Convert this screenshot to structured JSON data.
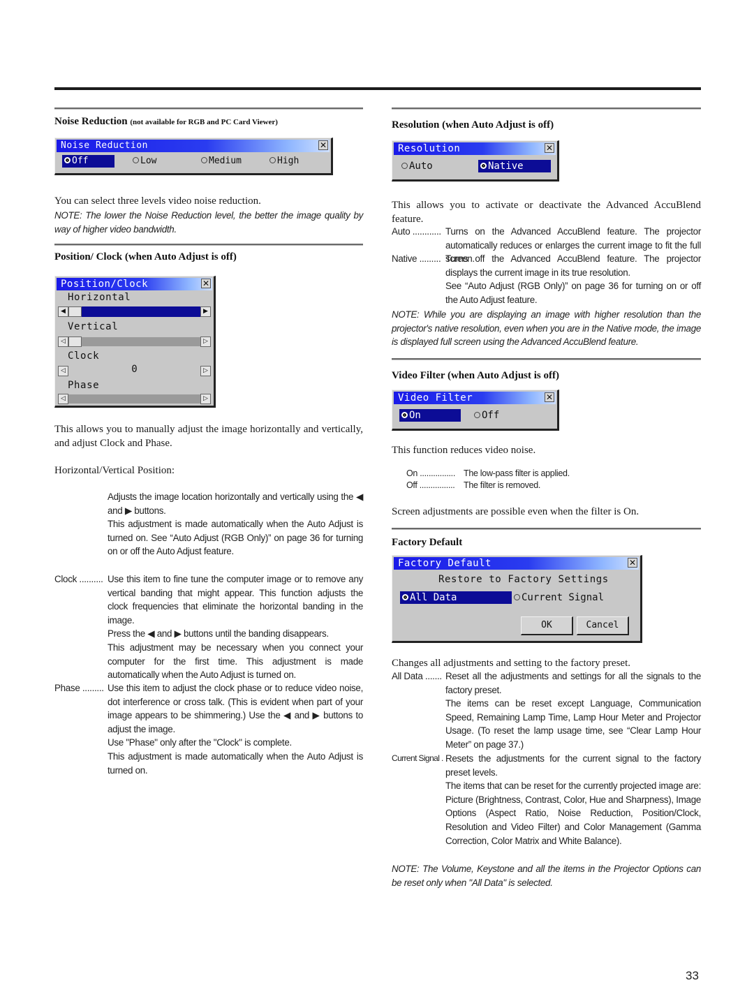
{
  "page_number": "33",
  "left": {
    "noise_reduction": {
      "heading": "Noise Reduction",
      "heading_note": "(not available for RGB and PC Card Viewer)",
      "dialog": {
        "title": "Noise Reduction",
        "options": [
          "Off",
          "Low",
          "Medium",
          "High"
        ],
        "selected": "Off"
      },
      "text": "You can select three levels video noise reduction.",
      "note": "NOTE: The lower the Noise Reduction level, the better the image quality by way of higher video bandwidth."
    },
    "position_clock": {
      "heading": "Position/ Clock (when Auto Adjust is off)",
      "dialog": {
        "title": "Position/Clock",
        "rows": [
          {
            "label": "Horizontal",
            "selected": true
          },
          {
            "label": "Vertical",
            "selected": false
          },
          {
            "label": "Clock",
            "value": "0",
            "selected": false
          },
          {
            "label": "Phase",
            "selected": false
          }
        ]
      },
      "intro": "This allows you to manually adjust the image horizontally and vertically, and adjust Clock and Phase.",
      "hv_label": "Horizontal/Vertical Position:",
      "hv_desc_1": "Adjusts the image location horizontally and vertically using the ◀ and ▶ buttons.",
      "hv_desc_2": "This adjustment is made automatically when the Auto Adjust is turned on. See “Auto Adjust (RGB Only)” on page 36 for turning on or off the Auto Adjust feature.",
      "clock_term": "Clock ..........",
      "clock_desc_1": "Use this item to fine tune the computer image or to remove any vertical banding that might appear. This function adjusts the clock frequencies that eliminate the horizontal banding in the image.",
      "clock_desc_2": "Press the ◀ and ▶ buttons until the banding disappears.",
      "clock_desc_3": "This adjustment may be necessary when you connect your computer for the first time. This adjustment is made automatically when the Auto Adjust is turned on.",
      "phase_term": "Phase .........",
      "phase_desc_1": "Use this item to adjust the clock phase or to reduce video noise, dot interference or cross talk. (This is evident when part of your image appears to be shimmering.) Use the ◀ and ▶ buttons to adjust the image.",
      "phase_desc_2": "Use \"Phase\" only after the \"Clock\" is complete.",
      "phase_desc_3": "This adjustment is made automatically when the Auto Adjust is turned on."
    }
  },
  "right": {
    "resolution": {
      "heading": "Resolution (when Auto Adjust is off)",
      "dialog": {
        "title": "Resolution",
        "options": [
          "Auto",
          "Native"
        ],
        "selected": "Native"
      },
      "intro": "This allows you to activate or deactivate the Advanced AccuBlend feature.",
      "auto_term": "Auto ............",
      "auto_desc": "Turns on the Advanced AccuBlend feature. The projector automatically reduces or enlarges the current image to fit the full screen.",
      "native_term": "Native .........",
      "native_desc_1": "Turns off the Advanced AccuBlend feature. The projector displays the current image in its true resolution.",
      "native_desc_2": "See “Auto Adjust (RGB Only)” on page 36 for turning on or off the Auto Adjust feature.",
      "note": "NOTE: While you are displaying an image with higher resolution than the projector's native resolution, even when you are in the Native mode, the image is displayed full screen using the Advanced AccuBlend feature."
    },
    "video_filter": {
      "heading": "Video Filter (when Auto Adjust is off)",
      "dialog": {
        "title": "Video Filter",
        "options": [
          "On",
          "Off"
        ],
        "selected": "On"
      },
      "intro": "This function reduces video noise.",
      "on_term": "On ................",
      "on_desc": "The low-pass filter is applied.",
      "off_term": "Off ................",
      "off_desc": "The filter is removed.",
      "footer": "Screen adjustments are possible even when the filter is On."
    },
    "factory_default": {
      "heading": "Factory Default",
      "dialog": {
        "title": "Factory Default",
        "subtitle": "Restore to Factory Settings",
        "options": [
          "All Data",
          "Current Signal"
        ],
        "selected": "All Data",
        "ok_label": "OK",
        "cancel_label": "Cancel"
      },
      "intro": "Changes all adjustments and setting to the factory preset.",
      "all_term": "All Data .......",
      "all_desc_1": "Reset all the adjustments and settings for all the signals to the factory preset.",
      "all_desc_2": "The items can be reset except Language, Communication Speed, Remaining Lamp Time, Lamp Hour Meter and Projector Usage. (To reset the lamp usage time, see “Clear Lamp Hour Meter” on page 37.)",
      "cur_term": "Current Signal .",
      "cur_desc_1": "Resets the adjustments for the current signal to the factory preset levels.",
      "cur_desc_2": "The items that can be reset for the currently projected image are: Picture (Brightness, Contrast, Color, Hue and Sharpness), Image Options (Aspect Ratio, Noise Reduction, Position/Clock, Resolution and Video Filter) and Color Management (Gamma Correction, Color Matrix and White Balance).",
      "note": "NOTE: The Volume, Keystone and all the items in the Projector Options can be reset only when \"All Data\" is selected."
    }
  }
}
